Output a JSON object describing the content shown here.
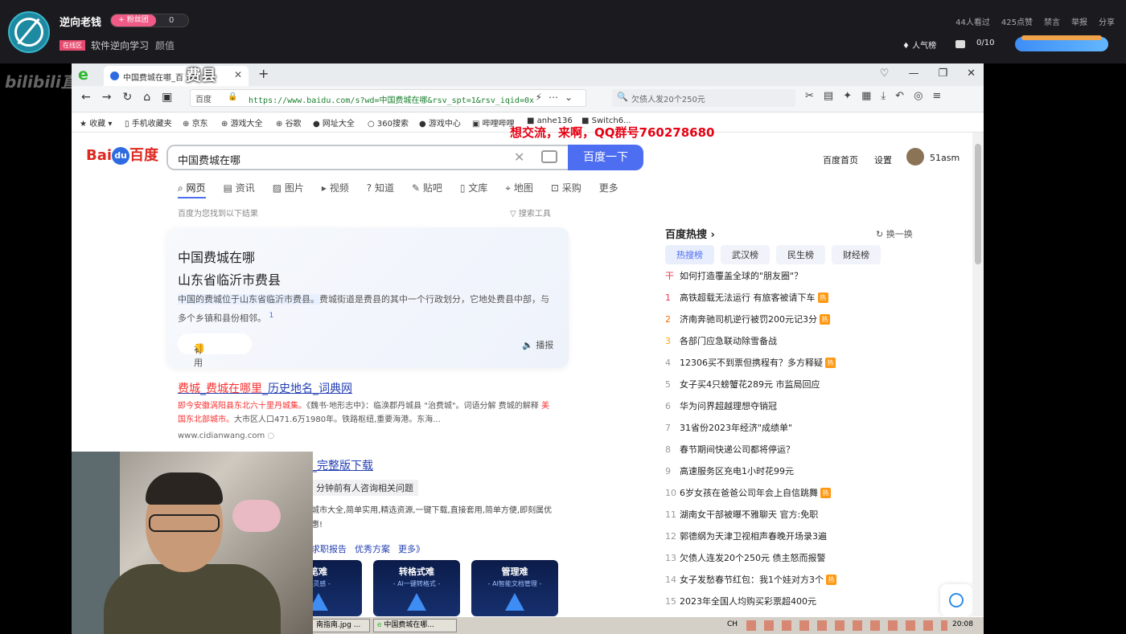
{
  "stream": {
    "streamer_name": "逆向老钱",
    "fan_badge": "+ 粉丝团",
    "fan_count": "0",
    "area_tag": "在线区",
    "category": "软件逆向学习",
    "quality": "颜值",
    "viewers": "44人看过",
    "likes": "425点赞",
    "mute": "禁言",
    "report": "举报",
    "share": "分享",
    "popularity": "人气榜",
    "gift_progress": "0/10",
    "watermark": "bilibili直"
  },
  "overlay": {
    "location_text": "费县",
    "qq_text": "想交流，来啊，QQ群号760278680"
  },
  "browser": {
    "tab_title": "中国费城在哪_百",
    "new_tab": "+",
    "address_label": "百度",
    "url": "https://www.baidu.com/s?wd=中国费城在哪&rsv_spt=1&rsv_iqid=0x",
    "side_search_placeholder": "欠债人发20个250元",
    "bookmarks": [
      "收藏",
      "手机收藏夹",
      "京东",
      "游戏大全",
      "谷歌",
      "网址大全",
      "360搜索",
      "游戏中心",
      "哔哩哔哩",
      "anhe136",
      "Switch6..."
    ]
  },
  "baidu": {
    "logo_text": "Bai",
    "logo_du": "du",
    "logo_cn": "百度",
    "query": "中国费城在哪",
    "search_button": "百度一下",
    "home_link": "百度首页",
    "settings_link": "设置",
    "username": "51asm",
    "tabs": [
      "网页",
      "资讯",
      "图片",
      "视频",
      "知道",
      "贴吧",
      "文库",
      "地图",
      "采购",
      "更多"
    ],
    "found_text": "百度为您找到以下结果",
    "search_tools": "搜索工具",
    "answer": {
      "question": "中国费城在哪",
      "answer": "山东省临沂市费县",
      "desc_highlight": "中国的费城位于山东省临沂市费县。",
      "desc_rest": "费城街道是费县的其中一个行政划分，它地处费县中部，与多个乡镇和县份相邻。",
      "footnote": "1",
      "useful": "有用",
      "play": "播报"
    },
    "result1": {
      "title_a": "费城",
      "title_sep": "_",
      "title_b": "费城在哪里",
      "title_c": "_历史地名_词典网",
      "desc_red": "即今安徽涡阳县东北六十里丹城集。",
      "desc_mid": "《魏书·地形志中》：临涣郡丹城县 \"治费城\"。词语分解 费城的解释",
      "desc_red2": "美国东北部城市。",
      "desc_end": "大市区人口471.6万1980年。铁路枢纽,重要海港。东海...",
      "url": "www.cidianwang.com"
    },
    "result2": {
      "title": "_完整版下载",
      "chip": "分钟前有人咨询相关问题",
      "desc": "城市大全,简单实用,精选资源,一键下载,直接套用,简单方便,即刻属优惠!",
      "links": [
        "求职报告",
        "优秀方案",
        "更多》"
      ]
    },
    "promos": [
      {
        "title": "笔难",
        "sub": "源灵感 -"
      },
      {
        "title": "转格式难",
        "sub": "- AI一键转格式 -"
      },
      {
        "title": "管理难",
        "sub": "- AI智能文档管理 -"
      }
    ],
    "hot": {
      "title": "百度热搜",
      "swap": "换一换",
      "tabs": [
        "热搜榜",
        "武汉榜",
        "民生榜",
        "财经榜"
      ],
      "items": [
        {
          "n": "干",
          "t": "如何打造覆盖全球的\"朋友圈\"？",
          "hot": false
        },
        {
          "n": "1",
          "t": "高铁超载无法运行 有旅客被请下车",
          "hot": true
        },
        {
          "n": "2",
          "t": "济南奔驰司机逆行被罚200元记3分",
          "hot": true
        },
        {
          "n": "3",
          "t": "各部门应急联动除雪备战",
          "hot": false
        },
        {
          "n": "4",
          "t": "12306买不到票但携程有？多方释疑",
          "hot": true
        },
        {
          "n": "5",
          "t": "女子买4只螃蟹花289元 市监局回应",
          "hot": false
        },
        {
          "n": "6",
          "t": "华为问界超越理想夺销冠",
          "hot": false
        },
        {
          "n": "7",
          "t": "31省份2023年经济\"成绩单\"",
          "hot": false
        },
        {
          "n": "8",
          "t": "春节期间快递公司都将停运？",
          "hot": false
        },
        {
          "n": "9",
          "t": "高速服务区充电1小时花99元",
          "hot": false
        },
        {
          "n": "10",
          "t": "6岁女孩在爸爸公司年会上自信跳舞",
          "hot": true
        },
        {
          "n": "11",
          "t": "湖南女干部被曝不雅聊天 官方:免职",
          "hot": false
        },
        {
          "n": "12",
          "t": "郭德纲为天津卫视相声春晚开场录3遍",
          "hot": false
        },
        {
          "n": "13",
          "t": "欠债人连发20个250元 债主怒而报警",
          "hot": false
        },
        {
          "n": "14",
          "t": "女子发愁春节红包：我1个娃对方3个",
          "hot": true
        },
        {
          "n": "15",
          "t": "2023年全国人均购买彩票超400元",
          "hot": false
        }
      ],
      "hot_badge": "热"
    }
  },
  "taskbar": {
    "item1": "南指南.jpg ...",
    "item2": "中国费城在哪...",
    "tray": "CH",
    "clock": "20:08"
  }
}
